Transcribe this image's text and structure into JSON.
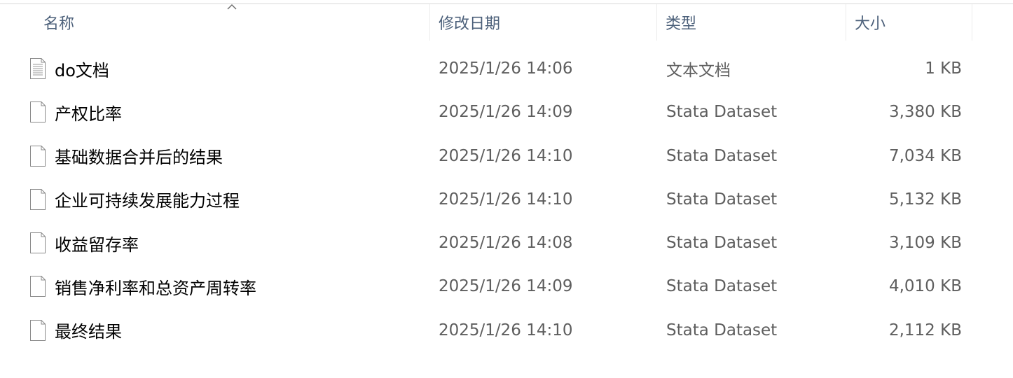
{
  "header": {
    "name_label": "名称",
    "date_label": "修改日期",
    "type_label": "类型",
    "size_label": "大小",
    "sort_icon": "chevron-up-icon"
  },
  "files": [
    {
      "name": "do文档",
      "modified": "2025/1/26 14:06",
      "type": "文本文档",
      "size": "1 KB",
      "icon": "text-file-icon"
    },
    {
      "name": "产权比率",
      "modified": "2025/1/26 14:09",
      "type": "Stata Dataset",
      "size": "3,380 KB",
      "icon": "blank-file-icon"
    },
    {
      "name": "基础数据合并后的结果",
      "modified": "2025/1/26 14:10",
      "type": "Stata Dataset",
      "size": "7,034 KB",
      "icon": "blank-file-icon"
    },
    {
      "name": "企业可持续发展能力过程",
      "modified": "2025/1/26 14:10",
      "type": "Stata Dataset",
      "size": "5,132 KB",
      "icon": "blank-file-icon"
    },
    {
      "name": "收益留存率",
      "modified": "2025/1/26 14:08",
      "type": "Stata Dataset",
      "size": "3,109 KB",
      "icon": "blank-file-icon"
    },
    {
      "name": "销售净利率和总资产周转率",
      "modified": "2025/1/26 14:09",
      "type": "Stata Dataset",
      "size": "4,010 KB",
      "icon": "blank-file-icon"
    },
    {
      "name": "最终结果",
      "modified": "2025/1/26 14:10",
      "type": "Stata Dataset",
      "size": "2,112 KB",
      "icon": "blank-file-icon"
    }
  ]
}
